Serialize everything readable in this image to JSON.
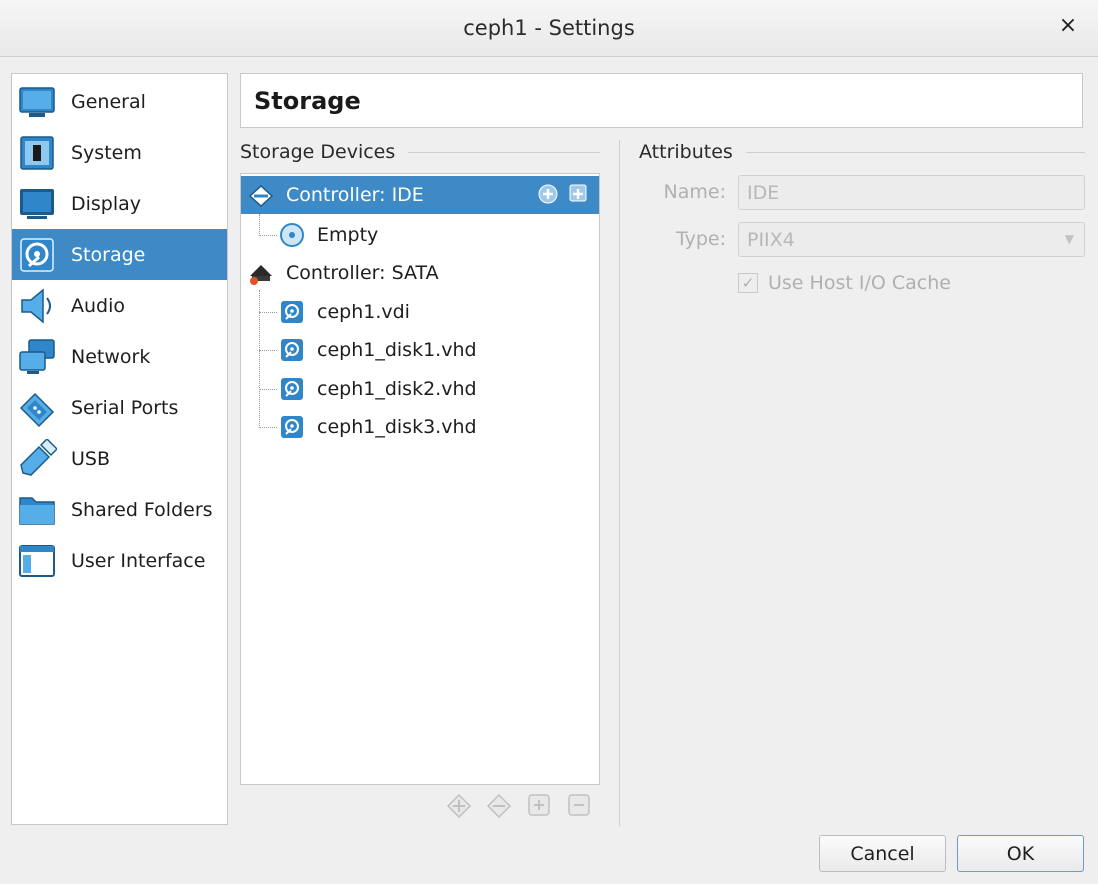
{
  "window": {
    "title": "ceph1 - Settings",
    "close_icon": "×"
  },
  "sidebar": {
    "items": [
      {
        "label": "General",
        "icon": "general-icon"
      },
      {
        "label": "System",
        "icon": "system-icon"
      },
      {
        "label": "Display",
        "icon": "display-icon"
      },
      {
        "label": "Storage",
        "icon": "storage-icon",
        "selected": true
      },
      {
        "label": "Audio",
        "icon": "audio-icon"
      },
      {
        "label": "Network",
        "icon": "network-icon"
      },
      {
        "label": "Serial Ports",
        "icon": "serial-ports-icon"
      },
      {
        "label": "USB",
        "icon": "usb-icon"
      },
      {
        "label": "Shared Folders",
        "icon": "shared-folders-icon"
      },
      {
        "label": "User Interface",
        "icon": "user-interface-icon"
      }
    ]
  },
  "page": {
    "title": "Storage"
  },
  "storage": {
    "section_label": "Storage Devices",
    "tree": [
      {
        "label": "Controller: IDE",
        "type": "controller-ide",
        "selected": true
      },
      {
        "label": "Empty",
        "type": "optical"
      },
      {
        "label": "Controller: SATA",
        "type": "controller-sata"
      },
      {
        "label": "ceph1.vdi",
        "type": "disk"
      },
      {
        "label": "ceph1_disk1.vhd",
        "type": "disk"
      },
      {
        "label": "ceph1_disk2.vhd",
        "type": "disk"
      },
      {
        "label": "ceph1_disk3.vhd",
        "type": "disk"
      }
    ]
  },
  "attributes": {
    "section_label": "Attributes",
    "name_label": "Name:",
    "name_value": "IDE",
    "type_label": "Type:",
    "type_value": "PIIX4",
    "host_cache_label": "Use Host I/O Cache",
    "host_cache_checked": true,
    "check_mark": "✓"
  },
  "buttons": {
    "cancel": "Cancel",
    "ok": "OK"
  },
  "colors": {
    "selection": "#3d8ac6",
    "icon_blue": "#2f86c8"
  }
}
